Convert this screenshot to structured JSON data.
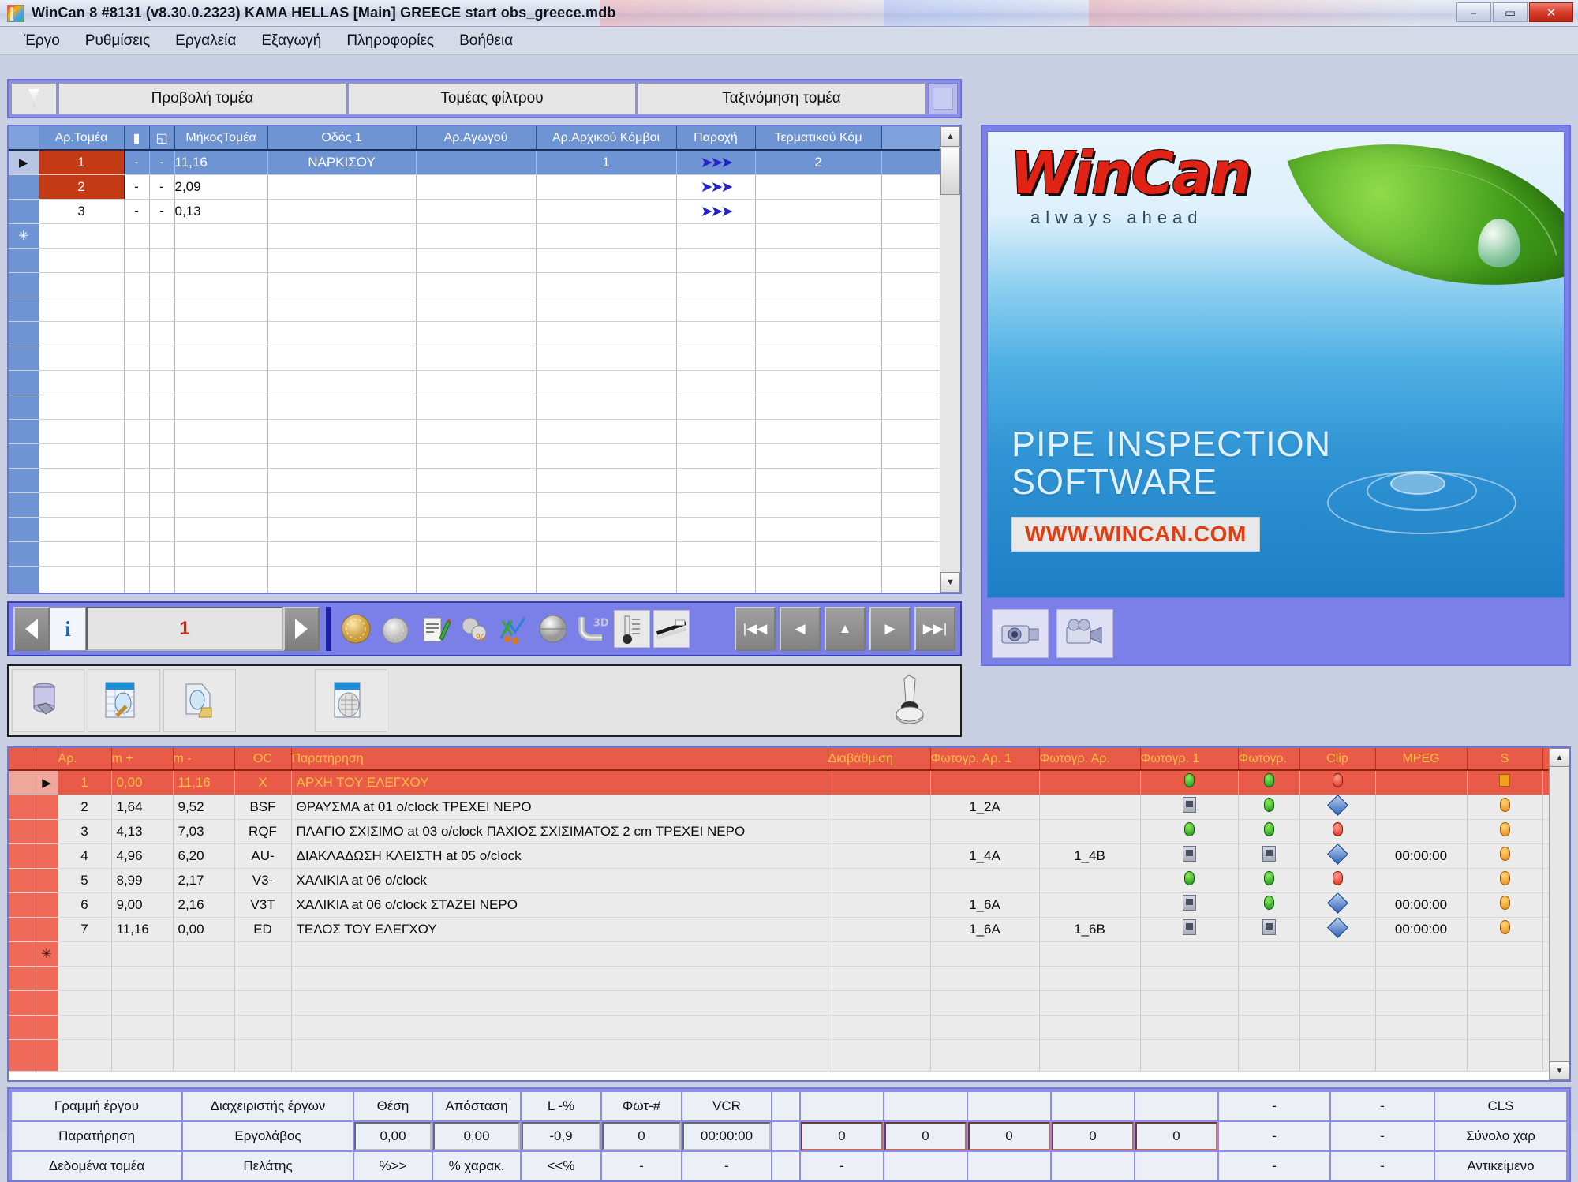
{
  "window": {
    "title": "WinCan 8 #8131  (v8.30.0.2323) KAMA HELLAS [Main]  GREECE  start  obs_greece.mdb",
    "app_icon": "wincan-app-icon",
    "minimize": "–",
    "maximize": "▭",
    "close": "✕"
  },
  "menu": [
    {
      "label": "Έργο"
    },
    {
      "label": "Ρυθμίσεις"
    },
    {
      "label": "Εργαλεία"
    },
    {
      "label": "Εξαγωγή"
    },
    {
      "label": "Πληροφορίες"
    },
    {
      "label": "Βοήθεια"
    }
  ],
  "section_tabs": {
    "filter_icon": "filter-funnel-icon",
    "tabs": [
      {
        "label": "Προβολή τομέα"
      },
      {
        "label": "Τομέας φίλτρου"
      },
      {
        "label": "Ταξινόμηση τομέα"
      }
    ]
  },
  "section_grid": {
    "columns": [
      "",
      "Αρ.Τομέα",
      "",
      "",
      "ΜήκοςΤομέα",
      "Οδός 1",
      "Αρ.Αγωγού",
      "Αρ.Αρχικού Κόμβοι",
      "Παροχή",
      "Τερματικού Κόμ"
    ],
    "rows": [
      {
        "marker": "▶",
        "id": "1",
        "c1": "-",
        "c2": "-",
        "length": "11,16",
        "street": "ΝΑΡΚΙΣΟΥ",
        "pipe": "",
        "start_node": "1",
        "flow": "flow-arrows-icon",
        "end_node": "2",
        "selected": true
      },
      {
        "marker": "",
        "id": "2",
        "c1": "-",
        "c2": "-",
        "length": "2,09",
        "street": "",
        "pipe": "",
        "start_node": "",
        "flow": "flow-arrows-icon",
        "end_node": "",
        "selected": false
      },
      {
        "marker": "",
        "id": "3",
        "c1": "-",
        "c2": "-",
        "length": "0,13",
        "street": "",
        "pipe": "",
        "start_node": "",
        "flow": "flow-arrows-icon",
        "end_node": "",
        "selected": false
      }
    ],
    "new_row_marker": "✳",
    "empty_rows": 12
  },
  "nav_toolbar": {
    "prev_label": "◀",
    "next_label": "▶",
    "info_label": "i",
    "record_value": "1",
    "tools": [
      {
        "name": "pipe-circle-icon",
        "glyph": "◍"
      },
      {
        "name": "pipe-gray-circle-icon",
        "glyph": "◌"
      },
      {
        "name": "notepad-pencil-icon",
        "glyph": "📝"
      },
      {
        "name": "stone-percent-icon",
        "glyph": "⛰"
      },
      {
        "name": "graph-scissors-icon",
        "glyph": "✂"
      },
      {
        "name": "sphere-3d-icon",
        "glyph": "◯"
      },
      {
        "name": "pipe-bend-3d-icon",
        "glyph": "3D"
      },
      {
        "name": "thermometer-icon",
        "glyph": "🌡"
      },
      {
        "name": "profile-view-icon",
        "glyph": "▬"
      }
    ],
    "end_buttons": [
      {
        "name": "first-record-button",
        "glyph": "|◀◀"
      },
      {
        "name": "prev-record-button",
        "glyph": "◀"
      },
      {
        "name": "up-record-button",
        "glyph": "▲"
      },
      {
        "name": "next-record-button",
        "glyph": "▶"
      },
      {
        "name": "last-record-button",
        "glyph": "▶▶|"
      }
    ]
  },
  "db_toolbar": {
    "buttons": [
      {
        "name": "database-button",
        "glyph": "🛢"
      },
      {
        "name": "database-search-button",
        "glyph": "🔍"
      },
      {
        "name": "database-print-button",
        "glyph": "🖨"
      },
      {
        "name": "database-grid-button",
        "glyph": "▦"
      },
      {
        "name": "printer-button",
        "glyph": "🖨"
      }
    ]
  },
  "banner": {
    "logo_word": "WinCan",
    "logo_tagline": "always ahead",
    "line1": "PIPE INSPECTION",
    "line2": "SOFTWARE",
    "url": "WWW.WINCAN.COM",
    "tool_icons": [
      {
        "name": "camera-icon",
        "glyph": "📷"
      },
      {
        "name": "video-camera-icon",
        "glyph": "🎥"
      }
    ]
  },
  "observation_grid": {
    "columns": [
      "",
      "Αρ.",
      "m +",
      "m -",
      "OC",
      "Παρατήρηση",
      "Διαβάθμιση",
      "Φωτογρ. Αρ. 1",
      "Φωτογρ. Αρ.",
      "Φωτογρ. 1",
      "Φωτογρ.",
      "Clip",
      "MPEG",
      "S"
    ],
    "rows": [
      {
        "marker": "▶",
        "no": "1",
        "mplus": "0,00",
        "mminus": "11,16",
        "oc": "X",
        "text": "ΑΡΧΗ ΤΟΥ ΕΛΕΓΧΟΥ",
        "grade": "",
        "photo_no1": "",
        "photo_no2": "",
        "photo1": "dot-green",
        "photo2": "dot-green",
        "clip": "dot-red",
        "mpeg": "",
        "s": "sq-orange",
        "selected": true
      },
      {
        "marker": "",
        "no": "2",
        "mplus": "1,64",
        "mminus": "9,52",
        "oc": "BSF",
        "text": "ΘΡΑΥΣΜΑ at 01 o/clock ΤΡΕΧΕΙ ΝΕΡΟ",
        "grade": "",
        "photo_no1": "1_2A",
        "photo_no2": "",
        "photo1": "photo-icon",
        "photo2": "dot-green",
        "clip": "clip-icon",
        "mpeg": "",
        "s": "dot-orange",
        "selected": false
      },
      {
        "marker": "",
        "no": "3",
        "mplus": "4,13",
        "mminus": "7,03",
        "oc": "RQF",
        "text": "ΠΛΑΓΙΟ ΣΧΙΣΙΜΟ at 03 o/clock ΠΑΧΙΟΣ ΣΧΙΣΙΜΑΤΟΣ 2 cm ΤΡΕΧΕΙ ΝΕΡΟ",
        "grade": "",
        "photo_no1": "",
        "photo_no2": "",
        "photo1": "dot-green",
        "photo2": "dot-green",
        "clip": "dot-red",
        "mpeg": "",
        "s": "dot-orange",
        "selected": false
      },
      {
        "marker": "",
        "no": "4",
        "mplus": "4,96",
        "mminus": "6,20",
        "oc": "AU-",
        "text": "ΔΙΑΚΛΑΔΩΣΗ ΚΛΕΙΣΤΗ at 05 o/clock",
        "grade": "",
        "photo_no1": "1_4A",
        "photo_no2": "1_4B",
        "photo1": "photo-icon",
        "photo2": "photo-icon",
        "clip": "clip-icon",
        "mpeg": "00:00:00",
        "s": "dot-orange",
        "selected": false
      },
      {
        "marker": "",
        "no": "5",
        "mplus": "8,99",
        "mminus": "2,17",
        "oc": "V3-",
        "text": "ΧΑΛΙΚΙΑ at 06 o/clock",
        "grade": "",
        "photo_no1": "",
        "photo_no2": "",
        "photo1": "dot-green",
        "photo2": "dot-green",
        "clip": "dot-red",
        "mpeg": "",
        "s": "dot-orange",
        "selected": false
      },
      {
        "marker": "",
        "no": "6",
        "mplus": "9,00",
        "mminus": "2,16",
        "oc": "V3T",
        "text": "ΧΑΛΙΚΙΑ at 06 o/clock ΣΤΑΖΕΙ ΝΕΡΟ",
        "grade": "",
        "photo_no1": "1_6A",
        "photo_no2": "",
        "photo1": "photo-icon",
        "photo2": "dot-green",
        "clip": "clip-icon",
        "mpeg": "00:00:00",
        "s": "dot-orange",
        "selected": false
      },
      {
        "marker": "",
        "no": "7",
        "mplus": "11,16",
        "mminus": "0,00",
        "oc": "ED",
        "text": "ΤΕΛΟΣ ΤΟΥ ΕΛΕΓΧΟΥ",
        "grade": "",
        "photo_no1": "1_6A",
        "photo_no2": "1_6B",
        "photo1": "photo-icon",
        "photo2": "photo-icon",
        "clip": "clip-icon",
        "mpeg": "00:00:00",
        "s": "dot-orange",
        "selected": false
      }
    ],
    "new_row_marker": "✳",
    "empty_rows": 4
  },
  "status_bar": {
    "row1": {
      "c1": "Γραμμή έργου",
      "c2": "Διαχειριστής έργων",
      "c3": "Θέση",
      "c4": "Απόσταση",
      "c5": "L -%",
      "c6": "Φωτ-#",
      "c7": "VCR",
      "c8": "",
      "c9": "",
      "c10": "",
      "c11": "",
      "c12": "",
      "c13": "",
      "c14": "-",
      "c15": "-",
      "c16": "CLS"
    },
    "row2": {
      "c1": "Παρατήρηση",
      "c2": "Εργολάβος",
      "c3": "0,00",
      "c4": "0,00",
      "c5": "-0,9",
      "c6": "0",
      "c7": "00:00:00",
      "c8": "0",
      "c9": "0",
      "c10": "0",
      "c11": "0",
      "c12": "0",
      "c13": "",
      "c14": "-",
      "c15": "-",
      "c16": "Σύνολο χαρ"
    },
    "row3": {
      "c1": "Δεδομένα τομέα",
      "c2": "Πελάτης",
      "c3": "%>>",
      "c4": "% χαρακ.",
      "c5": "<<%",
      "c6": "-",
      "c7": "-",
      "c8": "-",
      "c9": "",
      "c10": "",
      "c11": "",
      "c12": "",
      "c13": "",
      "c14": "-",
      "c15": "-",
      "c16": "Αντικείμενο"
    }
  },
  "colors": {
    "selection_blue": "#6f94d4",
    "row_red": "#c33a14",
    "obs_header_red": "#ea5a48",
    "obs_header_text": "#f5c242",
    "panel_purple": "#8b8fe8",
    "status_green": "#13e213",
    "status_red": "#f71616"
  }
}
